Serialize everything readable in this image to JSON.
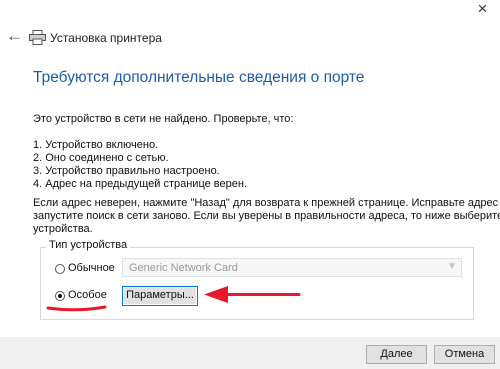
{
  "window": {
    "title": "Установка принтера",
    "close_icon": "×",
    "back_icon": "←"
  },
  "heading": "Требуются дополнительные сведения о порте",
  "intro": "Это устройство в сети не найдено. Проверьте, что:",
  "checklist": [
    "1.  Устройство включено.",
    "2.  Оно соединено с сетью.",
    "3.  Устройство правильно настроено.",
    "4.  Адрес на предыдущей странице верен."
  ],
  "advice": [
    "Если адрес неверен, нажмите \"Назад\" для возврата к прежней странице.  Исправьте адрес и",
    "запустите поиск в сети заново.  Если вы уверены в правильности адреса, то ниже выберите тип",
    "устройства."
  ],
  "device_type": {
    "group_label": "Тип устройства",
    "standard_label": "Обычное",
    "custom_label": "Особое",
    "selected": "custom",
    "standard_value": "Generic Network Card",
    "settings_button": "Параметры..."
  },
  "footer": {
    "next": "Далее",
    "cancel": "Отмена"
  },
  "colors": {
    "heading": "#1c5ea8",
    "annotation": "#e8192c",
    "focus": "#0078d7"
  }
}
